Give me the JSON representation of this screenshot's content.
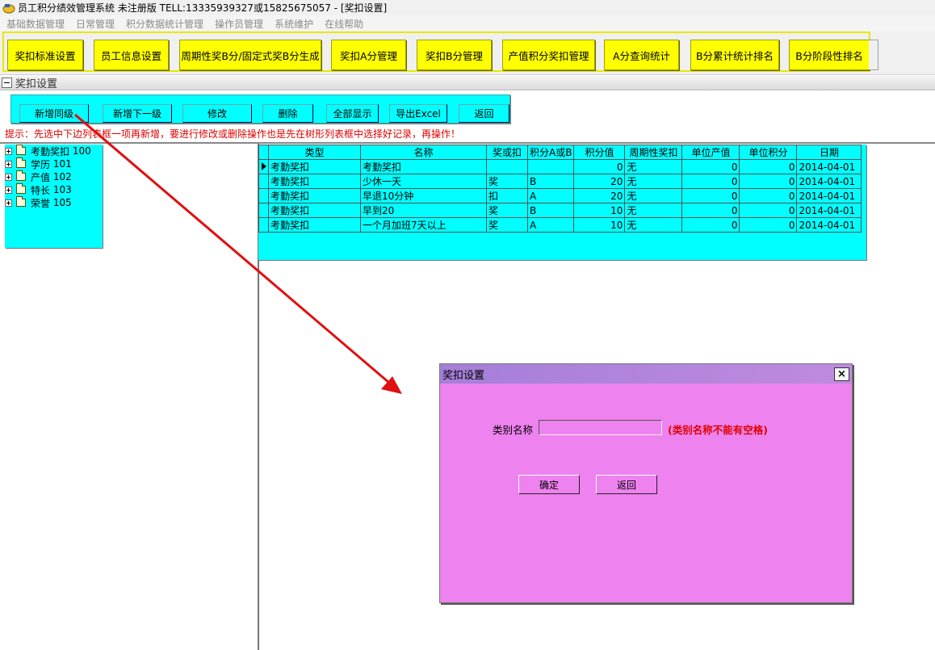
{
  "window": {
    "title": "员工积分绩效管理系统 未注册版 TELL:13335939327或15825675057 - [奖扣设置]",
    "icon": "app-logo-icon"
  },
  "menu": [
    "基础数据管理",
    "日常管理",
    "积分数据统计管理",
    "操作员管理",
    "系统维护",
    "在线帮助"
  ],
  "toolbar": {
    "buttons": [
      "奖扣标准设置",
      "员工信息设置",
      "周期性奖B分/固定式奖B分生成",
      "奖扣A分管理",
      "奖扣B分管理",
      "产值积分奖扣管理",
      "A分查询统计",
      "B分累计统计排名",
      "B分阶段性排名"
    ],
    "color": "#ffff00"
  },
  "section": {
    "title": "奖扣设置"
  },
  "actions": [
    "新增同级",
    "新增下一级",
    "修改",
    "删除",
    "全部显示",
    "导出Excel",
    "返回"
  ],
  "hint": "提示：先选中下边列表框一项再新增，要进行修改或删除操作也是先在树形列表框中选择好记录，再操作！",
  "tree": [
    {
      "label": "考勤奖扣",
      "code": "100"
    },
    {
      "label": "学历",
      "code": "101"
    },
    {
      "label": "产值",
      "code": "102"
    },
    {
      "label": "特长",
      "code": "103"
    },
    {
      "label": "荣誉",
      "code": "105"
    }
  ],
  "grid": {
    "columns": [
      "类型",
      "名称",
      "奖或扣",
      "积分A或B",
      "积分值",
      "周期性奖扣",
      "单位产值",
      "单位积分",
      "日期"
    ],
    "rows": [
      [
        "考勤奖扣",
        "考勤奖扣",
        "",
        "",
        "0",
        "无",
        "0",
        "0",
        "2014-04-01"
      ],
      [
        "考勤奖扣",
        "少休一天",
        "奖",
        "B",
        "20",
        "无",
        "0",
        "0",
        "2014-04-01"
      ],
      [
        "考勤奖扣",
        "早退10分钟",
        "扣",
        "A",
        "20",
        "无",
        "0",
        "0",
        "2014-04-01"
      ],
      [
        "考勤奖扣",
        "早到20",
        "奖",
        "B",
        "10",
        "无",
        "0",
        "0",
        "2014-04-01"
      ],
      [
        "考勤奖扣",
        "一个月加班7天以上",
        "奖",
        "A",
        "10",
        "无",
        "0",
        "0",
        "2014-04-01"
      ]
    ],
    "selected_row": 0
  },
  "dialog": {
    "title": "奖扣设置",
    "close": "×",
    "field_label": "类别名称",
    "field_value": "",
    "warning": "(类别名称不能有空格)",
    "ok": "确定",
    "cancel": "返回"
  },
  "colors": {
    "panel_cyan": "#00ffff",
    "dialog_magenta": "#ee82ee",
    "hint_red": "#e00000",
    "arrow_red": "#e01010"
  }
}
